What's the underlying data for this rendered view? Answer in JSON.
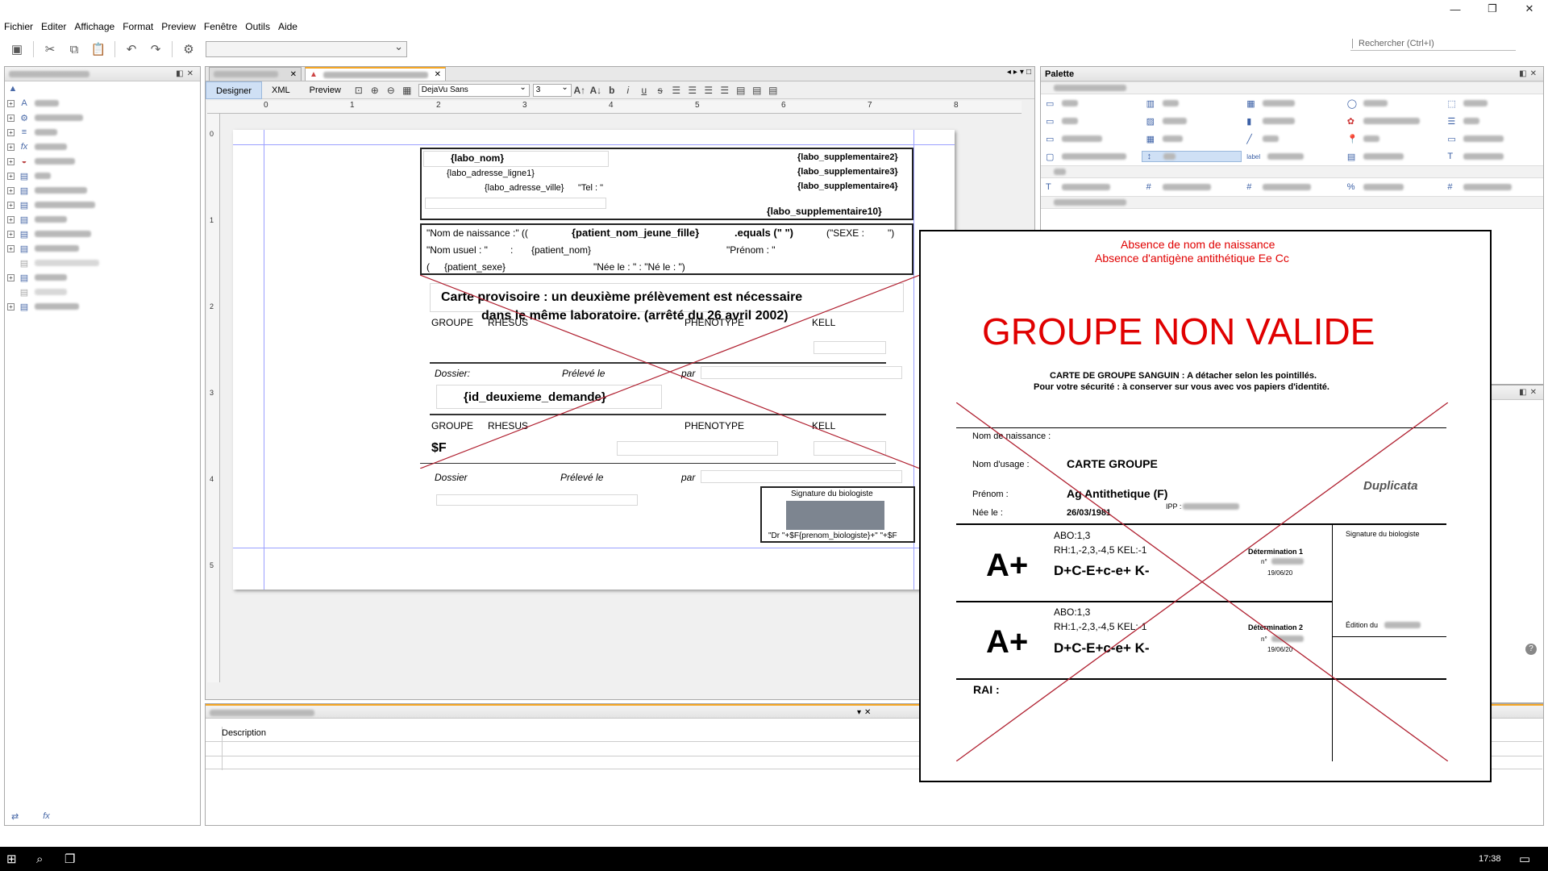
{
  "menu": [
    "Fichier",
    "Editer",
    "Affichage",
    "Format",
    "Preview",
    "Fenêtre",
    "Outils",
    "Aide"
  ],
  "search": {
    "placeholder": "Rechercher (Ctrl+I)"
  },
  "editor": {
    "modes": [
      "Designer",
      "XML",
      "Preview"
    ],
    "font_name": "DejaVu Sans",
    "font_size": "3",
    "ruler": [
      "0",
      "1",
      "2",
      "3",
      "4",
      "5",
      "6",
      "7",
      "8"
    ],
    "ruler_v": [
      "0",
      "1",
      "2",
      "3",
      "4",
      "5"
    ]
  },
  "report": {
    "labo_nom": "{labo_nom}",
    "labo_adresse_ligne1": "{labo_adresse_ligne1}",
    "labo_adresse_ville": "{labo_adresse_ville}",
    "tel": "\"Tel : \"",
    "labo_sup2": "{labo_supplementaire2}",
    "labo_sup3": "{labo_supplementaire3}",
    "labo_sup4": "{labo_supplementaire4}",
    "labo_sup10": "{labo_supplementaire10}",
    "nom_naissance": "\"Nom de naissance :\" ((",
    "patient_nom_jeune_fille": "{patient_nom_jeune_fille}",
    "equals": ".equals (\" \")",
    "sexe": "(\"SEXE :",
    "sexe_end": "\")",
    "nom_usuel": "\"Nom usuel : \"",
    "colon": ":",
    "patient_nom": "{patient_nom}",
    "prenom": "\"Prénom : \"",
    "paren": "(",
    "patient_sexe": "{patient_sexe}",
    "nee_le": "\"Née le : \" : \"Né le : \")",
    "carte_provisoire_1": "Carte provisoire : un deuxième prélèvement est nécessaire",
    "carte_provisoire_2": "dans le même laboratoire. (arrêté du 26 avril 2002)",
    "groupe": "GROUPE",
    "rhesus": "RHESUS",
    "phenotype": "PHENOTYPE",
    "kell": "KELL",
    "dossier": "Dossier:",
    "preleve_le": "Prélevé le",
    "par": "par",
    "id_deuxieme_demande": "{id_deuxieme_demande}",
    "groupe2": "GROUPE",
    "rhesus2": "RHESUS",
    "phenotype2": "PHENOTYPE",
    "kell2": "KELL",
    "dollar_f": "$F",
    "dossier2": "Dossier",
    "preleve_le2": "Prélevé le",
    "par2": "par",
    "signature_biologiste": "Signature du biologiste",
    "dr_biologiste": "\"Dr \"+$F{prenom_biologiste}+\" \"+$F"
  },
  "palette": {
    "title": "Palette",
    "label_icon": "label"
  },
  "bottom": {
    "column": "Description"
  },
  "card": {
    "absence_1": "Absence de nom de naissance",
    "absence_2": "Absence d'antigène antithétique Ee  Cc",
    "groupe_non_valide": "GROUPE NON  VALIDE",
    "carte_groupe_sanguin": "CARTE DE GROUPE SANGUIN :  A détacher selon les pointillés.",
    "securite": "Pour votre sécurité : à conserver sur vous avec vos papiers d'identité.",
    "nom_naissance": "Nom de naissance :",
    "nom_usage": "Nom d'usage :",
    "carte_groupe": "CARTE GROUPE",
    "duplicata": "Duplicata",
    "prenom_label": "Prénom :",
    "prenom_value": "Ag Antithetique (F)",
    "nee_label": "Née le :",
    "nee_value": "26/03/1981",
    "ipp": "IPP :",
    "signature": "Signature du biologiste",
    "edition": "Édition du",
    "abo_1": "ABO:1,3",
    "rh_1": "RH:1,-2,3,-4,5  KEL:-1",
    "group_1": "A+",
    "pheno_1": "D+C-E+c-e+ K-",
    "det_1": "Détermination 1",
    "num_1": "n°",
    "date_1": "19/06/20",
    "abo_2": "ABO:1,3",
    "rh_2": "RH:1,-2,3,-4,5  KEL:-1",
    "group_2": "A+",
    "pheno_2": "D+C-E+c-e+ K-",
    "det_2": "Détermination 2",
    "num_2": "n°",
    "date_2": "19/06/20",
    "rai": "RAI :"
  },
  "taskbar": {
    "time": "17:38"
  }
}
